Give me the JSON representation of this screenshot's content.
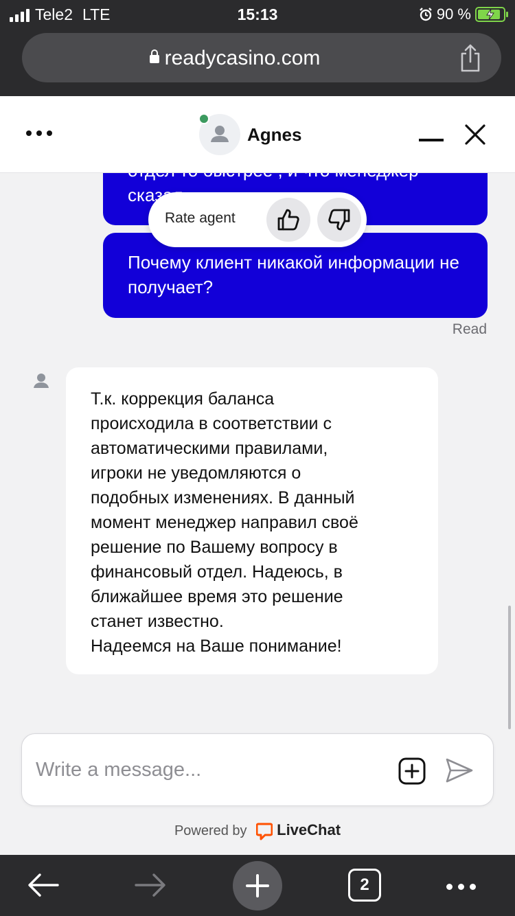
{
  "status_bar": {
    "carrier": "Tele2",
    "network": "LTE",
    "time": "15:13",
    "battery": "90 %",
    "battery_level": 0.9
  },
  "browser": {
    "url": "readycasino.com",
    "tabs_count": "2"
  },
  "chat": {
    "agent_name": "Agnes",
    "status_color": "#3c9a5f",
    "rate_label": "Rate agent",
    "messages": [
      {
        "from": "user",
        "text": "отдел то быстрее , и что менеджер сказал"
      },
      {
        "from": "user",
        "text": "Почему клиент никакой информации не получает?"
      },
      {
        "from": "agent",
        "text": "Т.к. коррекция баланса\nпроисходила в соответствии с\nавтоматическими правилами,\nигроки не уведомляются о\nподобных изменениях. В данный\nмомент менеджер направил своё\nрешение по Вашему вопросу в\nфинансовый отдел. Надеюсь, в\nближайшее время это решение\nстанет известно.\nНадеемся на Ваше понимание!"
      }
    ],
    "read_label": "Read"
  },
  "composer": {
    "placeholder": "Write a message..."
  },
  "footer": {
    "powered_by": "Powered by",
    "brand": "LiveChat"
  },
  "colors": {
    "user_bubble": "#1200d8",
    "browser_chrome": "#2b2b2d",
    "livechat_orange": "#ff5100"
  }
}
